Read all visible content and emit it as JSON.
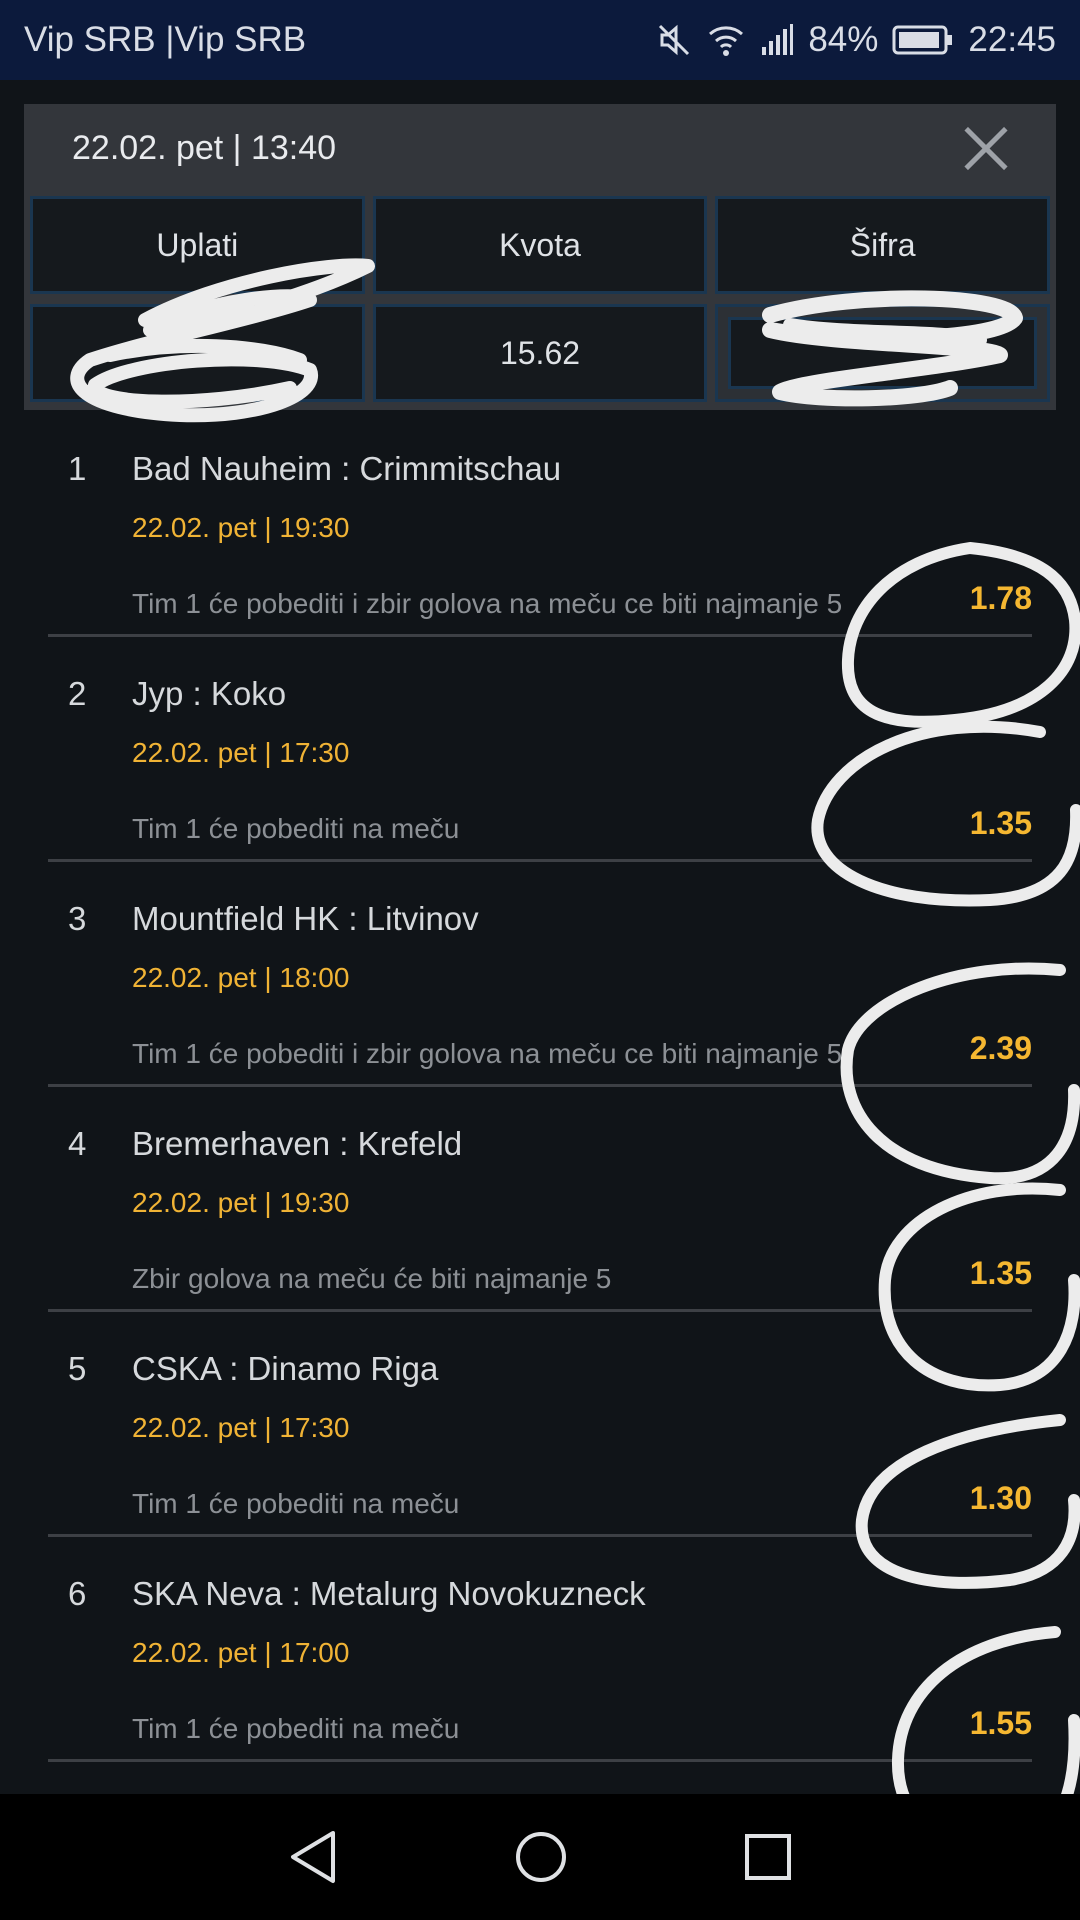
{
  "status_bar": {
    "carrier": "Vip SRB |Vip SRB",
    "battery": "84%",
    "time": "22:45"
  },
  "ticket": {
    "date": "22.02. pet | 13:40",
    "headers": {
      "pay": "Uplati",
      "odds": "Kvota",
      "code": "Šifra"
    },
    "total_odds": "15.62"
  },
  "matches": [
    {
      "num": "1",
      "teams": "Bad Nauheim : Crimmitschau",
      "date": "22.02. pet | 19:30",
      "bet": "Tim 1 će pobediti i zbir golova na meču ce biti najmanje 5",
      "odd": "1.78"
    },
    {
      "num": "2",
      "teams": "Jyp : Koko",
      "date": "22.02. pet | 17:30",
      "bet": "Tim 1 će pobediti na meču",
      "odd": "1.35"
    },
    {
      "num": "3",
      "teams": "Mountfield HK : Litvinov",
      "date": "22.02. pet | 18:00",
      "bet": "Tim 1 će pobediti i zbir golova na meču ce biti najmanje 5",
      "odd": "2.39"
    },
    {
      "num": "4",
      "teams": "Bremerhaven : Krefeld",
      "date": "22.02. pet | 19:30",
      "bet": "Zbir golova na meču će biti najmanje 5",
      "odd": "1.35"
    },
    {
      "num": "5",
      "teams": "CSKA : Dinamo Riga",
      "date": "22.02. pet | 17:30",
      "bet": "Tim 1 će pobediti na meču",
      "odd": "1.30"
    },
    {
      "num": "6",
      "teams": "SKA Neva : Metalurg Novokuzneck",
      "date": "22.02. pet | 17:00",
      "bet": "Tim 1 će pobediti na meču",
      "odd": "1.55"
    }
  ],
  "icons": {
    "mute": "mute-icon",
    "wifi": "wifi-icon",
    "signal": "signal-icon",
    "battery": "battery-icon",
    "close": "close-icon",
    "back": "back-icon",
    "home": "home-icon",
    "recents": "recents-icon"
  },
  "colors": {
    "accent": "#f5b731",
    "status_bar": "#0c1a3c",
    "background": "#101418"
  }
}
